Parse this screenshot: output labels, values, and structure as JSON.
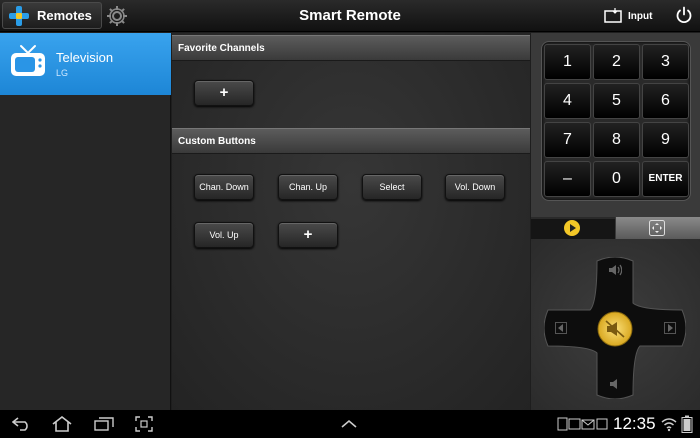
{
  "topbar": {
    "remotes_label": "Remotes",
    "title": "Smart Remote",
    "input_label": "Input"
  },
  "sidebar": {
    "devices": [
      {
        "name": "Television",
        "brand": "LG",
        "selected": true
      }
    ]
  },
  "main": {
    "favorite_header": "Favorite Channels",
    "favorite_add_label": "+",
    "custom_header": "Custom Buttons",
    "custom_buttons": [
      "Chan. Down",
      "Chan. Up",
      "Select",
      "Vol. Down",
      "Vol. Up"
    ],
    "custom_add_label": "+"
  },
  "keypad": {
    "keys": [
      "1",
      "2",
      "3",
      "4",
      "5",
      "6",
      "7",
      "8",
      "9",
      "–",
      "0",
      "ENTER"
    ]
  },
  "controls": {
    "active_tab": "play",
    "accent_color": "#f3c727"
  },
  "statusbar": {
    "time": "12:35"
  },
  "colors": {
    "selection": "#2a95e6",
    "accent": "#e8b824"
  }
}
